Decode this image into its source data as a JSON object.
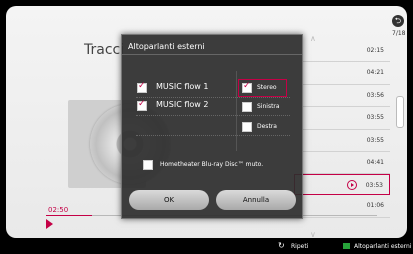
{
  "background": {
    "title": "Tracci",
    "time_elapsed": "02:50",
    "progress_fraction": 0.14,
    "page_indicator": "7/18",
    "track_times": [
      "02:15",
      "04:21",
      "03:56",
      "03:55",
      "03:55",
      "04:41",
      "03:53",
      "01:06"
    ],
    "selected_track_index": 6
  },
  "dialog": {
    "title": "Altoparlanti esterni",
    "devices": [
      {
        "label": "MUSIC flow 1",
        "checked": true
      },
      {
        "label": "MUSIC flow 2",
        "checked": true
      }
    ],
    "channels": [
      {
        "label": "Stereo",
        "checked": true
      },
      {
        "label": "Sinistra",
        "checked": false
      },
      {
        "label": "Destra",
        "checked": false
      }
    ],
    "mute_label": "Hometheater Blu-ray Disc™ muto.",
    "ok_label": "OK",
    "cancel_label": "Annulla"
  },
  "bottom_bar": {
    "repeat_label": "Ripeti",
    "speakers_label": "Altoparlanti esterni"
  },
  "colors": {
    "accent": "#c40046",
    "green": "#27a33a"
  }
}
